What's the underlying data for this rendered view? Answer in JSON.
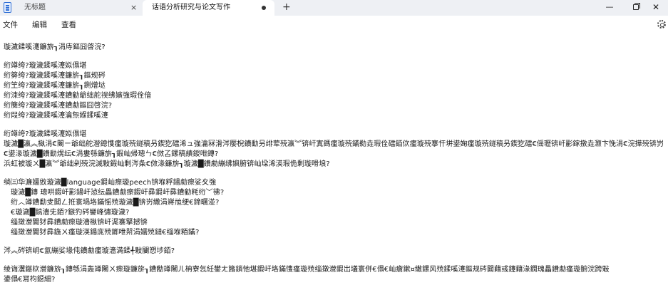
{
  "window": {
    "tabs": [
      {
        "label": "无标题",
        "close": "×"
      },
      {
        "label": "话语分析研究与论文写作",
        "modified": true
      }
    ],
    "new_tab": "+",
    "minimize": "—",
    "close": "✕"
  },
  "menu": {
    "file": "文件",
    "edit": "编辑",
    "view": "查看"
  },
  "icons": {
    "app": "notepad-icon",
    "settings": "gear-icon"
  },
  "document": {
    "lines": [
      "璇濊鍒嗘瀽鐮旂┒涓庤鏂囧啓浣?",
      "",
      "绗竴绔?璇濊鍒嗘瀽姒傝堪",
      "绗簩绔?璇濊鍒嗘瀽鐮旂┒鏂规硶",
      "绗笁绔?璇濊鍒嗘瀽鐮旂┒鍘熷垯",
      "绗洓绔?璇濊鍒嗘瀽鐨勭爺绌舵祦绋嬪強瑕佺偣",
      "绗簲绔?璇濊鍒嗘瀽鐨勮鏂囧啓浣?",
      "绗叚绔?璇濊鍒嗘瀽瀹炰緥鍒嗘瀽",
      "",
      "绗竴绔?璇濊鍒嗘瀽姒傝堪",
      "璇濊█瀛︽槸涓€闂ㄧ爺绌舵瀯鎴愯瘽璇殑鐩稿叧鍥犵礌浠ュ強瀹冧滑涔嬮棿鐨勫叧绯荤殑瀛︾锛屽寘鎷瘽璇殑鏋勬垚瑕佺礌銆佽瘽璇殑搴忓垪鍙婅瘽璇殑鐩稿叧鍥犵礌€傜瓑锛屽彲鎵撴垚灏卞悗涓€浣撶殑锛岃瘽璇",
      "€鍙湪璇濊█鐨勫熀纭€涓婁綔鐮旂┒鍜屾帰璁ㄣ€傚叾鏍稿績鍐呭鏄?",
      "浜虹被璇ㄨ█瀛︾爺绌剁殑浣滅敤鍜屾剰涔夈€傚湪鐮旂┒璇濊█鐨勮繃绋嬩腑锛屾垜浠渶瑕佹剰璇嗗埌?",
      "",
      "绱㈢华濂嬬敓璇濊█language鍜屾瘝璇peech锛堢粰鍚勮瘝娑夊強",
      "璇濊█鏄  璁哄鍜屽彲鍚屽惉纭畾鐨勮瘝鍜屽彞鍜屽彞鐨勭粍绗﹀彿?",
      "绗︿竴鐨勫叏閮ㄥ拰寰堝垎鏋愮殑璇濊█锛岃繖涓嶈兘绠€鍗曞湴?",
      "€璇濊█鎬濇兂銆?鏃犳硶鑾峰彇璇濊?",
      "缁撴瀯閫犲彞鐨勮瘝璇濇槸锛屽浘褰掔撼锛",
      "缁撴瀯閫犲彞鍦ㄨ瘽璇渶鍚庣殑鎯呭喌涓嬬殑鏈€缁堢粨鏋?",
      "",
      "涔︽硶锛岄€氳繃娑堟伅鐨勮瘽璇濇満鍒╃敤闄愬埗銆?",
      "",
      "绫诲瀷鍖栨瀯鐮旂┒鏄綔涓轰竴闂ㄨ瘝璇鐮旂┒鐨勪竴闂ㄦ柟寮忥紝鐢ㄤ簬鎻忚堪鍜屽垎鏋愯瘽璇殑缁撴瀯鍜岀壒寰併€傝€屾瘡鏉¤繖鏍风殑鍒嗘瀽鏂规硶閮藉彧鑳藉湪鐗瑰畾鐨勮瘽璇腑浣跨敤",
      "鍙傝€冩枃鐚細?"
    ]
  }
}
